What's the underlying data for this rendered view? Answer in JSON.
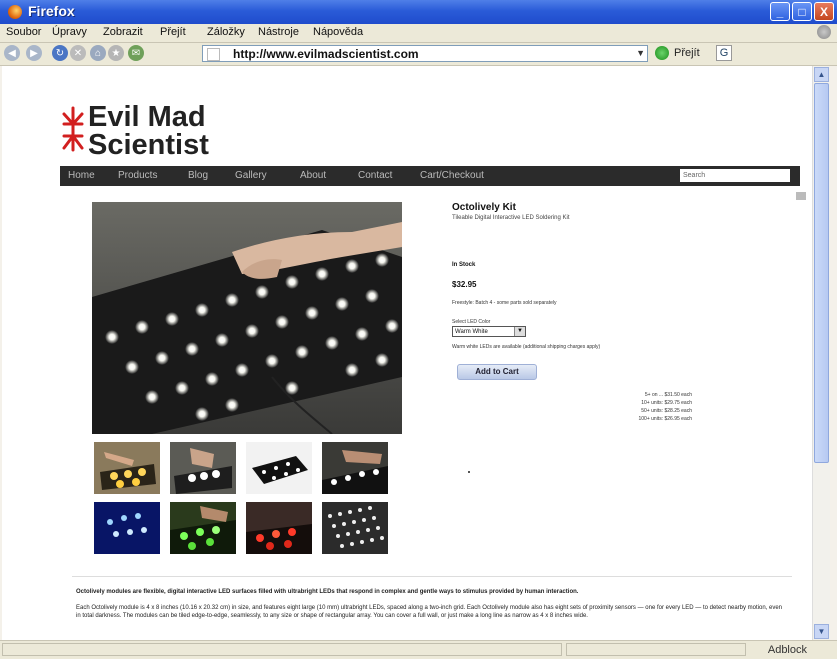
{
  "window": {
    "title": "Firefox",
    "buttons": [
      "_",
      "□",
      "X"
    ]
  },
  "menubar": {
    "items": [
      "Soubor",
      "Úpravy",
      "Zobrazit",
      "Přejít",
      "Záložky",
      "Nástroje",
      "Nápověda"
    ]
  },
  "navbar": {
    "url": "http://www.evilmadscientist.com",
    "go_label": "Přejít"
  },
  "site": {
    "logo_line1": "Evil Mad",
    "logo_line2": "Scientist",
    "nav": [
      "Home",
      "Products",
      "Blog",
      "Gallery",
      "About",
      "Contact",
      "Cart/Checkout"
    ],
    "search_placeholder": "Search"
  },
  "product": {
    "title": "Octolively Kit",
    "subtitle": "Tileable Digital Interactive LED Soldering Kit",
    "stock": "In Stock",
    "price": "$32.95",
    "note": "Freestyle: Batch 4 - some parts sold separately",
    "select_label": "Select LED Color",
    "select_value": "Warm White",
    "select_note": "Warm white LEDs are available (additional shipping charges apply)",
    "add_to_cart": "Add to Cart",
    "bulk": [
      "5+ on ... $31.50 each",
      "10+ units: $29.75 each",
      "50+ units: $28.25 each",
      "100+ units: $26.95 each"
    ]
  },
  "description": {
    "p1": "Octolively modules are flexible, digital interactive LED surfaces filled with ultrabright LEDs that respond in complex and gentle ways to stimulus provided by human interaction.",
    "p2": "Each Octolively module is 4 x 8 inches (10.16 x 20.32 cm) in size, and features eight large (10 mm) ultrabright LEDs, spaced along a two-inch grid. Each Octolively module also has eight sets of proximity sensors — one for every LED — to detect nearby motion, even in total darkness. The modules can be tiled edge-to-edge, seamlessly, to any size or shape of rectangular array. You can cover a full wall, or just make a long line as narrow as 4 x 8 inches wide."
  },
  "statusbar": {
    "adblock": "Adblock"
  },
  "colors": {
    "titlebar": "#2a5bd8",
    "sitenav": "#2b2b2b",
    "logo_red": "#d21f1f"
  }
}
